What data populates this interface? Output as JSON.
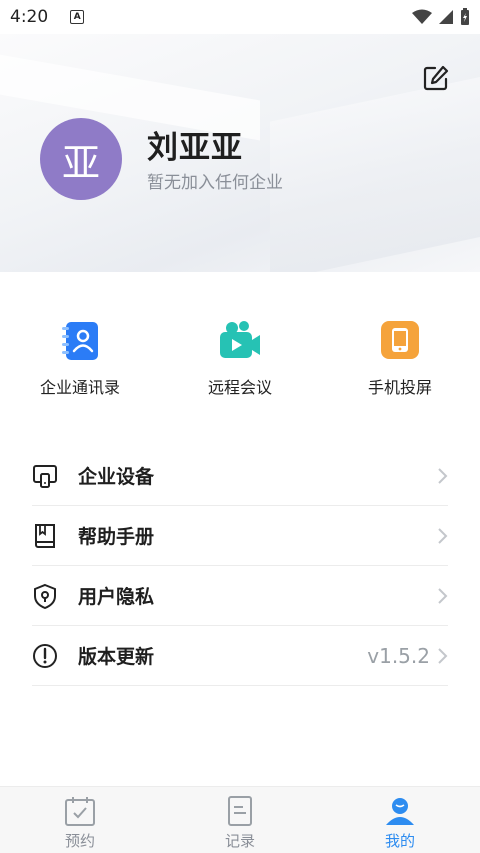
{
  "status_bar": {
    "time": "4:20",
    "notif_letter": "A"
  },
  "profile": {
    "avatar_text": "亚",
    "name": "刘亚亚",
    "subtitle": "暂无加入任何企业",
    "avatar_color": "#8f7bc7"
  },
  "quick_actions": [
    {
      "label": "企业通讯录",
      "icon": "contacts-book-icon"
    },
    {
      "label": "远程会议",
      "icon": "video-camera-icon"
    },
    {
      "label": "手机投屏",
      "icon": "phone-cast-icon"
    }
  ],
  "menu": [
    {
      "label": "企业设备",
      "icon": "device-icon",
      "value": ""
    },
    {
      "label": "帮助手册",
      "icon": "book-icon",
      "value": ""
    },
    {
      "label": "用户隐私",
      "icon": "shield-icon",
      "value": ""
    },
    {
      "label": "版本更新",
      "icon": "info-icon",
      "value": "v1.5.2"
    }
  ],
  "tabs": [
    {
      "label": "预约",
      "icon": "calendar-check-icon",
      "active": false
    },
    {
      "label": "记录",
      "icon": "document-icon",
      "active": false
    },
    {
      "label": "我的",
      "icon": "user-icon",
      "active": true
    }
  ],
  "colors": {
    "accent": "#2d8cf0",
    "contacts": "#2b7cf6",
    "meeting": "#26c2b4",
    "cast": "#f5a33b"
  }
}
